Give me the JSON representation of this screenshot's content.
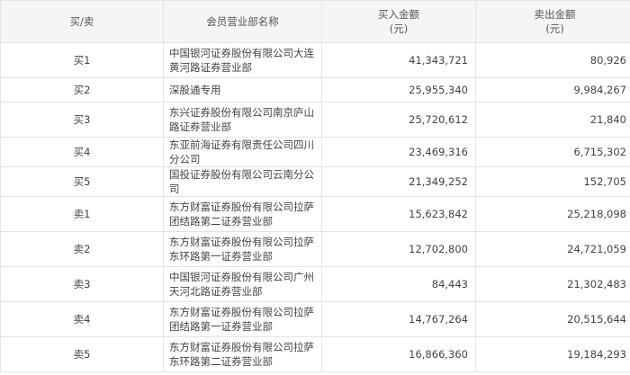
{
  "header": {
    "side": "买/卖",
    "dept": "会员营业部名称",
    "buy_line1": "买入金额",
    "buy_line2": "(元)",
    "sell_line1": "卖出金额",
    "sell_line2": "(元)"
  },
  "rows": [
    {
      "side": "买1",
      "dept": "中国银河证券股份有限公司大连黄河路证券营业部",
      "buy": "41,343,721",
      "sell": "80,926"
    },
    {
      "side": "买2",
      "dept": "深股通专用",
      "buy": "25,955,340",
      "sell": "9,984,267"
    },
    {
      "side": "买3",
      "dept": "东兴证券股份有限公司南京庐山路证券营业部",
      "buy": "25,720,612",
      "sell": "21,840"
    },
    {
      "side": "买4",
      "dept": "东亚前海证券有限责任公司四川分公司",
      "buy": "23,469,316",
      "sell": "6,715,302"
    },
    {
      "side": "买5",
      "dept": "国投证券股份有限公司云南分公司",
      "buy": "21,349,252",
      "sell": "152,705"
    },
    {
      "side": "卖1",
      "dept": "东方财富证券股份有限公司拉萨团结路第二证券营业部",
      "buy": "15,623,842",
      "sell": "25,218,098"
    },
    {
      "side": "卖2",
      "dept": "东方财富证券股份有限公司拉萨东环路第一证券营业部",
      "buy": "12,702,800",
      "sell": "24,721,059"
    },
    {
      "side": "卖3",
      "dept": "中国银河证券股份有限公司广州天河北路证券营业部",
      "buy": "84,443",
      "sell": "21,302,483"
    },
    {
      "side": "卖4",
      "dept": "东方财富证券股份有限公司拉萨团结路第一证券营业部",
      "buy": "14,767,264",
      "sell": "20,515,644"
    },
    {
      "side": "卖5",
      "dept": "东方财富证券股份有限公司拉萨东环路第二证券营业部",
      "buy": "16,866,360",
      "sell": "19,184,293"
    }
  ]
}
